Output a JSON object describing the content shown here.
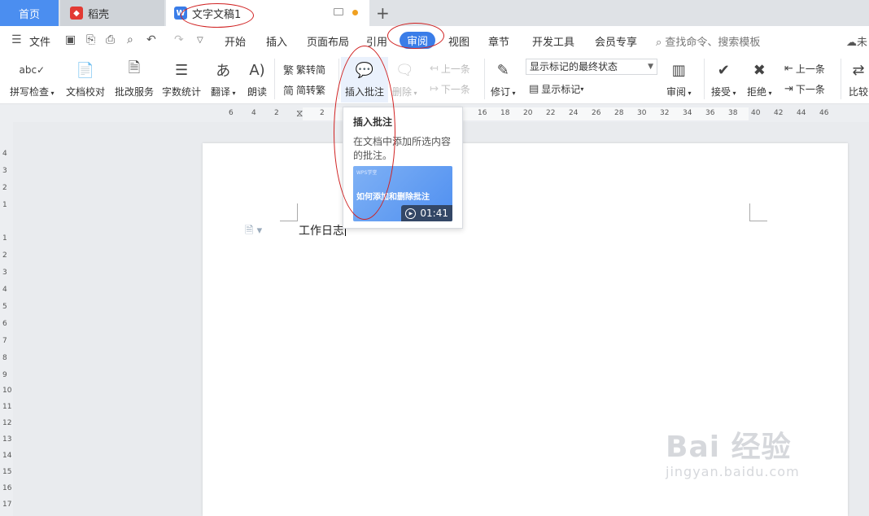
{
  "tabs": {
    "home": "首页",
    "daoke": "稻壳",
    "document": "文字文稿1",
    "add": "+"
  },
  "menu": {
    "file": "文件",
    "items": [
      "开始",
      "插入",
      "页面布局",
      "引用",
      "审阅",
      "视图",
      "章节",
      "开发工具",
      "会员专享"
    ],
    "active": "审阅",
    "search": "查找命令、搜索模板",
    "cloud": "未"
  },
  "ribbon": {
    "spellcheck": "拼写检查",
    "proofread": "文档校对",
    "correction": "批改服务",
    "wordcount": "字数统计",
    "translate": "翻译",
    "read": "朗读",
    "trad_to_simp": "繁转简",
    "simp_to_trad": "简转繁",
    "insert_comment": "插入批注",
    "delete": "删除",
    "prev_comment": "上一条",
    "next_comment": "下一条",
    "track": "修订",
    "final_state": "显示标记的最终状态",
    "show_markup": "显示标记",
    "review": "审阅",
    "accept": "接受",
    "reject": "拒绝",
    "prev_change": "上一条",
    "next_change": "下一条",
    "compare": "比较"
  },
  "tooltip": {
    "title": "插入批注",
    "description": "在文档中添加所选内容的批注。",
    "video_title": "如何添加和删除批注",
    "video_brand": "WPS学堂",
    "duration": "01:41"
  },
  "ruler": {
    "ticks": [
      "6",
      "4",
      "2",
      "2",
      "4",
      "16",
      "18",
      "20",
      "22",
      "24",
      "26",
      "28",
      "30",
      "32",
      "34",
      "36",
      "38",
      "40",
      "42",
      "44",
      "46"
    ],
    "vticks": [
      "4",
      "3",
      "2",
      "1",
      "1",
      "2",
      "3",
      "4",
      "5",
      "6",
      "7",
      "8",
      "9",
      "10",
      "11",
      "12",
      "13",
      "14",
      "15",
      "16",
      "17"
    ]
  },
  "document": {
    "text": "工作日志"
  },
  "watermark": {
    "main": "Bai 经验",
    "sub": "jingyan.baidu.com"
  },
  "colors": {
    "accent": "#3a7de8",
    "annotation": "#d02020"
  }
}
